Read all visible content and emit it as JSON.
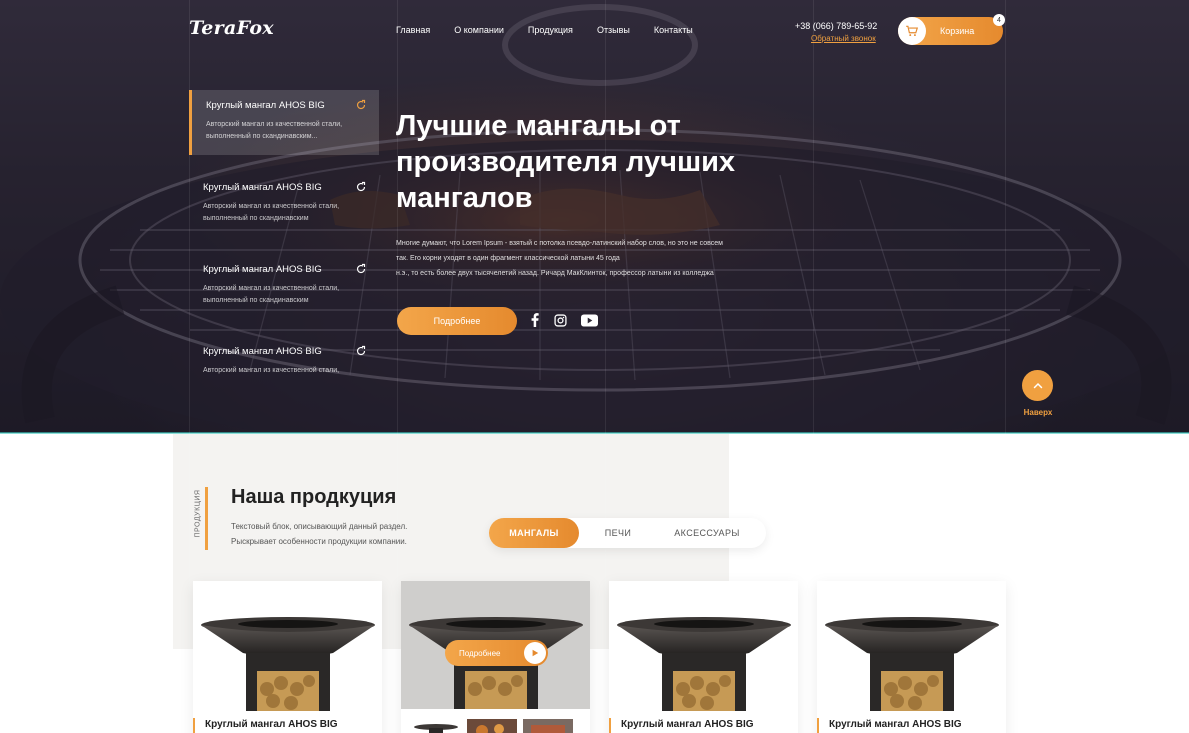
{
  "header": {
    "logo": "TeraFox",
    "nav": [
      "Главная",
      "О компании",
      "Продукция",
      "Отзывы",
      "Контакты"
    ],
    "phone": "+38 (066) 789-65-92",
    "callback": "Обратный звонок",
    "cart_label": "Корзина",
    "cart_count": "4"
  },
  "side_list": [
    {
      "title": "Круглый мангал AHOS BIG",
      "desc": "Авторский мангал из качественной стали, выполненный по скандинавским..."
    },
    {
      "title": "Круглый мангал AHOS BIG",
      "desc": "Авторский мангал из качественной стали, выполненный по скандинавским"
    },
    {
      "title": "Круглый мангал AHOS BIG",
      "desc": "Авторский мангал из качественной стали, выполненный по скандинавским"
    },
    {
      "title": "Круглый мангал AHOS BIG",
      "desc": "Авторский мангал из качественной стали,"
    }
  ],
  "hero": {
    "title": "Лучшие мангалы от производителя лучших мангалов",
    "text": [
      "Многие думают, что Lorem Ipsum - взятый с потолка псевдо-латинский набор слов, но это не совсем",
      "так. Его корни уходят в один фрагмент классической латыни 45 года",
      "н.э., то есть более двух тысячелетий назад. Ричард МакКлинток, профессор латыни из колледжа"
    ],
    "more_button": "Подробнее",
    "up_label": "Наверх"
  },
  "products": {
    "vertical_label": "ПРОДУКЦИЯ",
    "title": "Наша продкуция",
    "desc": [
      "Текстовый блок, описывающий данный раздел.",
      "Рыскрывает особенности продукции компании."
    ],
    "tabs": [
      "МАНГАЛЫ",
      "ПЕЧИ",
      "АКСЕССУАРЫ"
    ],
    "cards": [
      {
        "name": "Круглый мангал AHOS BIG"
      },
      {
        "name": "Круглый мангал AHOS BIG"
      },
      {
        "name": "Круглый мангал AHOS BIG"
      },
      {
        "name": "Круглый мангал AHOS BIG"
      }
    ],
    "card_button": "Подробнее"
  },
  "colors": {
    "accent": "#f0a040",
    "hero_dark": "#2c2734"
  }
}
